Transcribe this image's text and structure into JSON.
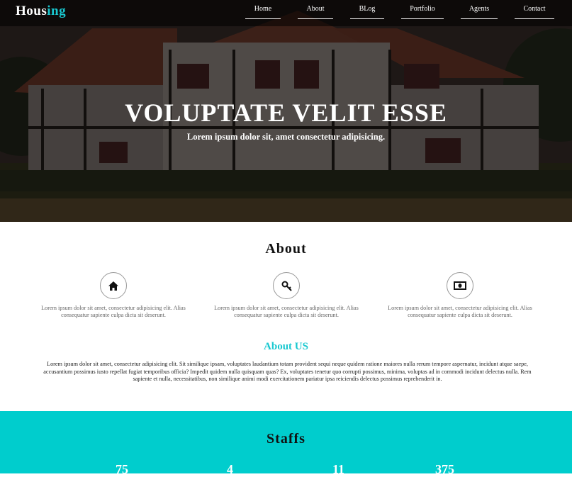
{
  "nav": {
    "logo_main": "Hous",
    "logo_accent": "ing",
    "items": [
      {
        "label": "Home"
      },
      {
        "label": "About"
      },
      {
        "label": "BLog"
      },
      {
        "label": "Portfolio"
      },
      {
        "label": "Agents"
      },
      {
        "label": "Contact"
      }
    ]
  },
  "hero": {
    "title": "VOLUPTATE VELIT ESSE",
    "subtitle": "Lorem ipsum dolor sit, amet consectetur adipisicing."
  },
  "about": {
    "title": "About",
    "features": [
      {
        "icon": "home-icon",
        "text": "Lorem ipsum dolor sit amet, consectetur adipisicing elit. Alias consequatur sapiente culpa dicta sit deserunt."
      },
      {
        "icon": "key-icon",
        "text": "Lorem ipsum dolor sit amet, consectetur adipisicing elit. Alias consequatur sapiente culpa dicta sit deserunt."
      },
      {
        "icon": "money-icon",
        "text": "Lorem ipsum dolor sit amet, consectetur adipisicing elit. Alias consequatur sapiente culpa dicta sit deserunt."
      }
    ]
  },
  "about_us": {
    "title": "About US",
    "text": "Lorem ipsum dolor sit amet, consectetur adipisicing elit. Sit similique ipsam, voluptates laudantium totam provident sequi neque quidem ratione maiores nulla rerum tempore aspernatur, incidunt atque saepe, accusantium possimus iusto repellat fugiat temporibus officia? Impedit quidem nulla quisquam quas? Ex, voluptates tenetur quo corrupti possimus, minima, voluptas ad in commodi incidunt delectus nulla. Rem sapiente et nulla, necessitatibus, non similique animi modi exercitationem pariatur ipsa reiciendis delectus possimus reprehenderit in."
  },
  "staffs": {
    "title": "Staffs",
    "stats": [
      "75",
      "4",
      "11",
      "375"
    ]
  },
  "colors": {
    "accent": "#19c8d0",
    "staffs_bg": "#00cdcd"
  }
}
